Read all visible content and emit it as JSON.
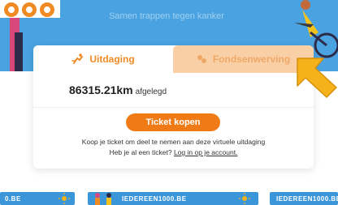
{
  "hero": {
    "tagline": "Samen trappen tegen kanker"
  },
  "card": {
    "tabs": [
      {
        "label": "Uitdaging",
        "icon": "cyclist-icon"
      },
      {
        "label": "Fondsenwerving",
        "icon": "coins-icon"
      }
    ],
    "distance_value": "86315.21km",
    "distance_suffix": "afgelegd",
    "ticket_button": "Ticket kopen",
    "description": "Koop je ticket om deel te nemen aan deze virtuele uitdaging",
    "login_prefix": "Heb je al een ticket?",
    "login_link": "Log in op je account."
  },
  "banners": [
    {
      "label": "0.BE"
    },
    {
      "label": "IEDEREEN1000.BE"
    },
    {
      "label": "IEDEREEN1000.BE"
    }
  ],
  "colors": {
    "hero": "#4aa3e0",
    "accent": "#f07b16",
    "tab_inactive": "#f9cfa6",
    "banner": "#3b96d9",
    "arrow": "#f6b21a"
  }
}
